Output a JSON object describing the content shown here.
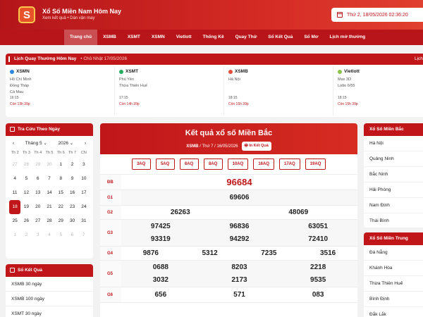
{
  "header": {
    "logo_letter": "S",
    "title": "Xổ Số Miền Nam Hôm Nay",
    "subtitle": "Xem kết quả • Dàn vận may",
    "datetime": "Thứ 2, 18/05/2026 02:36:20"
  },
  "nav": [
    "Trang chủ",
    "XSMB",
    "XSMT",
    "XSMN",
    "Vietlott",
    "Thống Kê",
    "Quay Thử",
    "Sổ Kết Quả",
    "Sổ Mơ",
    "Lịch mở thưởng"
  ],
  "schedule": {
    "title": "Lịch Quay Thưởng Hôm Nay",
    "subtitle": "• Chủ Nhật 17/05/2026",
    "more": "Lịch",
    "columns": [
      {
        "name": "XSMN",
        "color": "#2e86de",
        "provinces": [
          "Hồ Chí Minh",
          "Đồng Tháp",
          "Cà Mau"
        ],
        "time": "16:15",
        "remain": "Còn 13h 39p"
      },
      {
        "name": "XSMT",
        "color": "#27ae60",
        "provinces": [
          "Phú Yên",
          "Thừa Thiên Huế"
        ],
        "time": "17:15",
        "remain": "Còn 14h 39p"
      },
      {
        "name": "XSMB",
        "color": "#e74c3c",
        "provinces": [
          "Hà Nội"
        ],
        "time": "18:15",
        "remain": "Còn 15h 39p"
      },
      {
        "name": "Vietlott",
        "color": "#8bc34a",
        "provinces": [
          "Max 3D",
          "Lotto 6/55"
        ],
        "time": "18:15",
        "remain": "Còn 15h 39p"
      }
    ]
  },
  "calendar": {
    "title": "Tra Cứu Theo Ngày",
    "month": "Tháng 5",
    "year": "2026",
    "prev": "‹",
    "next": "›",
    "dow": [
      "Th 2",
      "Th 3",
      "Th 4",
      "Th 5",
      "Th 6",
      "Th 7",
      "CN"
    ],
    "days": [
      [
        "27",
        "28",
        "29",
        "30",
        "1",
        "2",
        "3"
      ],
      [
        "4",
        "5",
        "6",
        "7",
        "8",
        "9",
        "10"
      ],
      [
        "11",
        "12",
        "13",
        "14",
        "15",
        "16",
        "17"
      ],
      [
        "18",
        "19",
        "20",
        "21",
        "22",
        "23",
        "24"
      ],
      [
        "25",
        "26",
        "27",
        "28",
        "29",
        "30",
        "31"
      ],
      [
        "1",
        "2",
        "3",
        "4",
        "5",
        "6",
        "7"
      ]
    ],
    "selected": "18"
  },
  "so_ket_qua": {
    "title": "Sổ Kết Quả",
    "items": [
      "XSMB 30 ngày",
      "XSMB 100 ngày",
      "XSMT 30 ngày"
    ]
  },
  "result": {
    "title": "Kết quả xổ số Miền Bắc",
    "region": "XSMB",
    "date": "/ Thứ 7 / 16/05/2026",
    "print_button": "In Kết Quả",
    "codes": [
      "3AQ",
      "5AQ",
      "6AQ",
      "8AQ",
      "10AQ",
      "16AQ",
      "17AQ",
      "19AQ"
    ],
    "prizes": [
      {
        "label": "ĐB",
        "numbers": [
          "96684"
        ]
      },
      {
        "label": "G1",
        "numbers": [
          "69606"
        ]
      },
      {
        "label": "G2",
        "numbers": [
          "26263",
          "48069"
        ]
      },
      {
        "label": "G3",
        "numbers": [
          "97425",
          "96836",
          "63051",
          "93319",
          "94292",
          "72410"
        ]
      },
      {
        "label": "G4",
        "numbers": [
          "9876",
          "5312",
          "7235",
          "3516"
        ]
      },
      {
        "label": "G5",
        "numbers": [
          "0688",
          "8203",
          "2218",
          "3032",
          "2173",
          "9535"
        ]
      },
      {
        "label": "G6",
        "numbers": [
          "656",
          "571",
          "083"
        ]
      }
    ]
  },
  "mien_bac": {
    "title": "Xổ Số Miền Bắc",
    "items": [
      "Hà Nội",
      "Quảng Ninh",
      "Bắc Ninh",
      "Hải Phòng",
      "Nam Định",
      "Thái Bình"
    ]
  },
  "mien_trung": {
    "title": "Xổ Số Miền Trung",
    "items": [
      "Đà Nẵng",
      "Khánh Hòa",
      "Thừa Thiên Huế",
      "Bình Định",
      "Đắk Lắk"
    ]
  }
}
